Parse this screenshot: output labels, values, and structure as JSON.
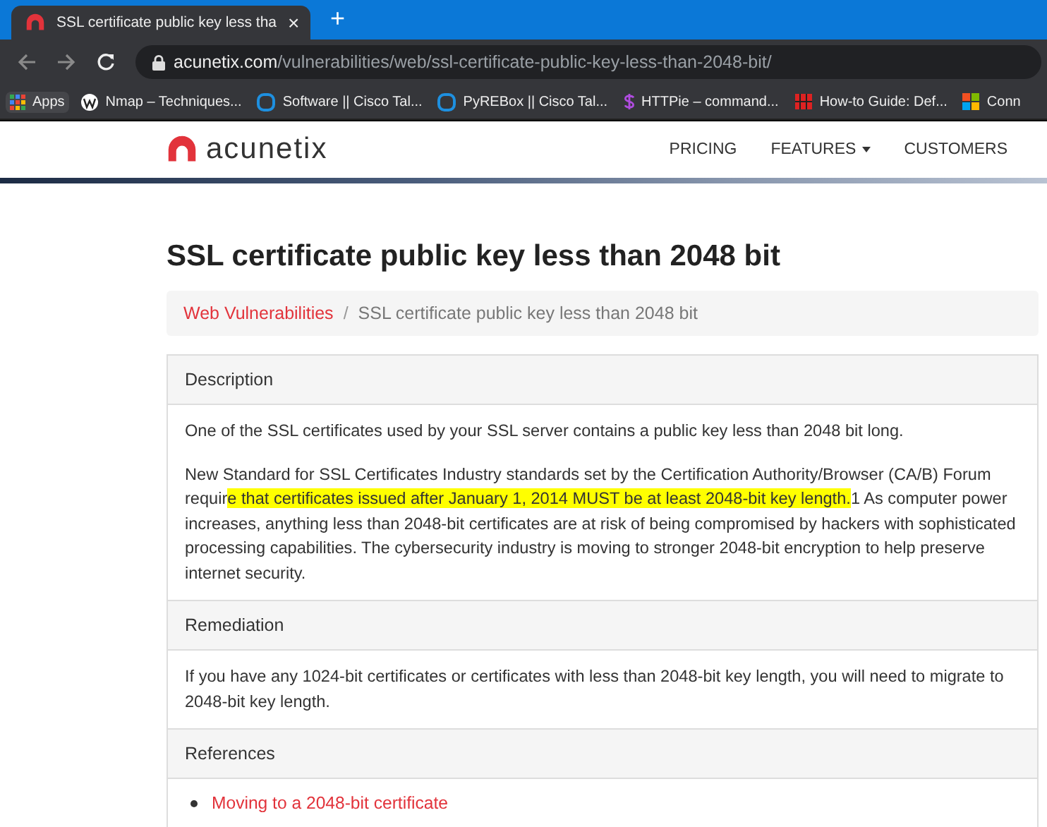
{
  "browser": {
    "tab": {
      "title": "SSL certificate public key less tha",
      "close": "×",
      "selected": true
    },
    "new_tab": "+",
    "url": {
      "domain": "acunetix.com",
      "path": "/vulnerabilities/web/ssl-certificate-public-key-less-than-2048-bit/"
    },
    "bookmarks": [
      {
        "label": "Apps",
        "kind": "apps"
      },
      {
        "label": "Nmap – Techniques...",
        "kind": "wordpress"
      },
      {
        "label": "Software || Cisco Tal...",
        "kind": "ring"
      },
      {
        "label": "PyREBox || Cisco Tal...",
        "kind": "ring"
      },
      {
        "label": "HTTPie – command...",
        "kind": "dollar"
      },
      {
        "label": "How-to Guide: Def...",
        "kind": "grid"
      },
      {
        "label": "Conn",
        "kind": "windows"
      }
    ]
  },
  "site": {
    "logo": "acunetix",
    "nav": [
      {
        "label": "PRICING",
        "dropdown": false
      },
      {
        "label": "FEATURES",
        "dropdown": true
      },
      {
        "label": "CUSTOMERS",
        "dropdown": false
      }
    ]
  },
  "page": {
    "title": "SSL certificate public key less than 2048 bit",
    "breadcrumb_separator": "/",
    "breadcrumb": [
      {
        "label": "Web Vulnerabilities",
        "link": true
      },
      {
        "label": "SSL certificate public key less than 2048 bit",
        "link": false
      }
    ],
    "sections": [
      {
        "heading": "Description",
        "paragraphs": [
          [
            {
              "text": "One of the SSL certificates used by your SSL server contains a public key less than 2048 bit long.",
              "highlighted": false
            }
          ],
          [
            {
              "text": "New Standard for SSL Certificates Industry standards set by the Certification Authority/Browser (CA/B) Forum requir",
              "highlighted": false
            },
            {
              "text": "e that certificates issued after January 1, 2014 MUST be at least 2048-bit key length.",
              "highlighted": true
            },
            {
              "text": "1 As computer power increases, anything less than 2048-bit certificates are at risk of being compromised by hackers with sophisticated processing capabilities. The cybersecurity industry is moving to stronger 2048-bit encryption to help preserve internet security.",
              "highlighted": false
            }
          ]
        ]
      },
      {
        "heading": "Remediation",
        "paragraphs": [
          [
            {
              "text": "If you have any 1024-bit certificates or certificates with less than 2048-bit key length, you will need to migrate to 2048-bit key length.",
              "highlighted": false
            }
          ]
        ]
      },
      {
        "heading": "References",
        "links": [
          "Moving to a 2048-bit certificate"
        ]
      }
    ]
  }
}
